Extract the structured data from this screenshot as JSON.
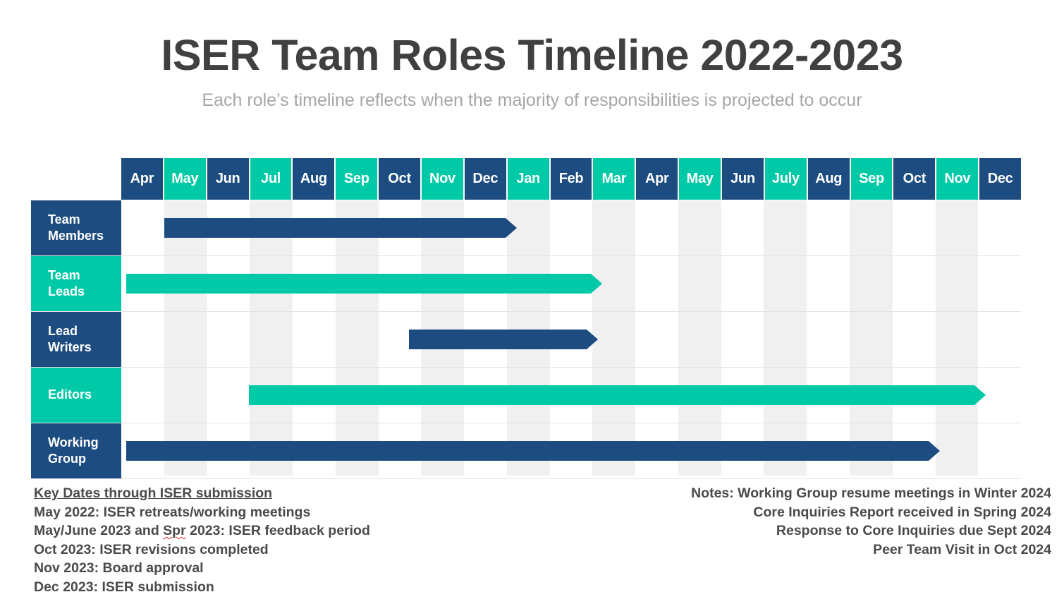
{
  "header": {
    "title": "ISER Team Roles Timeline 2022-2023",
    "subtitle": "Each role’s timeline reflects when the majority of responsibilities is projected to occur"
  },
  "colors": {
    "navy": "#1d4c80",
    "teal": "#00c9a7",
    "stripe": "#f0f0f0",
    "title_text": "#404040",
    "subtitle_text": "#a6a6a6",
    "footer_text": "#4a4a4a",
    "row_divider": "#e3e3e3",
    "spellcheck_underline": "#e03030"
  },
  "chart_data": {
    "type": "bar",
    "title": "ISER Team Roles Timeline 2022-2023",
    "subtitle": "Each role’s timeline reflects when the majority of responsibilities is projected to occur",
    "xlabel": "",
    "ylabel": "",
    "grid": true,
    "legend_position": "none",
    "categories": [
      "Apr",
      "May",
      "Jun",
      "Jul",
      "Aug",
      "Sep",
      "Oct",
      "Nov",
      "Dec",
      "Jan",
      "Feb",
      "Mar",
      "Apr",
      "May",
      "Jun",
      "July",
      "Aug",
      "Sep",
      "Oct",
      "Nov",
      "Dec"
    ],
    "series": [
      {
        "name": "Team Members",
        "color": "#1d4c80",
        "start_index": 1,
        "end_index": 9,
        "start_label": "May",
        "end_label": "Jan",
        "arrow": true
      },
      {
        "name": "Team Leads",
        "color": "#00c9a7",
        "start_index": 0,
        "end_index": 11,
        "start_label": "Apr",
        "end_label": "Mar",
        "arrow": true
      },
      {
        "name": "Lead Writers",
        "color": "#1d4c80",
        "start_index": 6,
        "end_index": 11,
        "start_label": "Oct",
        "end_label": "Mar",
        "arrow": true
      },
      {
        "name": "Editors",
        "color": "#00c9a7",
        "start_index": 3,
        "end_index": 20,
        "start_label": "Jul",
        "end_label": "Dec",
        "arrow": true
      },
      {
        "name": "Working Group",
        "color": "#1d4c80",
        "start_index": 0,
        "end_index": 19,
        "start_label": "Apr",
        "end_label": "Nov",
        "arrow": true
      }
    ]
  },
  "months": [
    {
      "label": "Apr",
      "fill": "navy"
    },
    {
      "label": "May",
      "fill": "teal"
    },
    {
      "label": "Jun",
      "fill": "navy"
    },
    {
      "label": "Jul",
      "fill": "teal"
    },
    {
      "label": "Aug",
      "fill": "navy"
    },
    {
      "label": "Sep",
      "fill": "teal"
    },
    {
      "label": "Oct",
      "fill": "navy"
    },
    {
      "label": "Nov",
      "fill": "teal"
    },
    {
      "label": "Dec",
      "fill": "navy"
    },
    {
      "label": "Jan",
      "fill": "teal"
    },
    {
      "label": "Feb",
      "fill": "navy"
    },
    {
      "label": "Mar",
      "fill": "teal"
    },
    {
      "label": "Apr",
      "fill": "navy"
    },
    {
      "label": "May",
      "fill": "teal"
    },
    {
      "label": "Jun",
      "fill": "navy"
    },
    {
      "label": "July",
      "fill": "teal"
    },
    {
      "label": "Aug",
      "fill": "navy"
    },
    {
      "label": "Sep",
      "fill": "teal"
    },
    {
      "label": "Oct",
      "fill": "navy"
    },
    {
      "label": "Nov",
      "fill": "teal"
    },
    {
      "label": "Dec",
      "fill": "navy"
    }
  ],
  "rows": [
    {
      "label_line1": "Team",
      "label_line2": "Members",
      "label_fill": "navy",
      "bar_color": "navy",
      "bar_start_pct": 4.78,
      "bar_width_pct": 39.2
    },
    {
      "label_line1": "Team",
      "label_leads_line2": "Leads",
      "label_line2": "Leads",
      "label_fill": "teal",
      "bar_color": "teal",
      "bar_start_pct": 0.55,
      "bar_width_pct": 52.9
    },
    {
      "label_line1": "Lead",
      "label_line2": "Writers",
      "label_fill": "navy",
      "bar_color": "navy",
      "bar_start_pct": 32.0,
      "bar_width_pct": 21.0
    },
    {
      "label_line1": "Editors",
      "label_line2": "",
      "label_fill": "teal",
      "bar_color": "teal",
      "bar_start_pct": 14.2,
      "bar_width_pct": 81.9
    },
    {
      "label_line1": "Working",
      "label_line2": "Group",
      "label_fill": "navy",
      "bar_color": "navy",
      "bar_start_pct": 0.55,
      "bar_width_pct": 90.4
    }
  ],
  "key_dates": {
    "heading": "Key Dates through ISER submission",
    "lines": [
      "May 2022: ISER retreats/working meetings",
      "Oct 2023: ISER revisions completed",
      "Nov 2023: Board approval",
      "Dec 2023: ISER submission"
    ],
    "feedback_line": {
      "prefix": "May/June 2023 and ",
      "misspelled": "Spr",
      "suffix": " 2023: ISER feedback period"
    }
  },
  "notes": {
    "lines": [
      "Notes: Working Group resume meetings in Winter 2024",
      "Core Inquiries Report received in Spring 2024",
      "Response to Core Inquiries due Sept 2024",
      "Peer Team Visit in Oct 2024"
    ]
  }
}
